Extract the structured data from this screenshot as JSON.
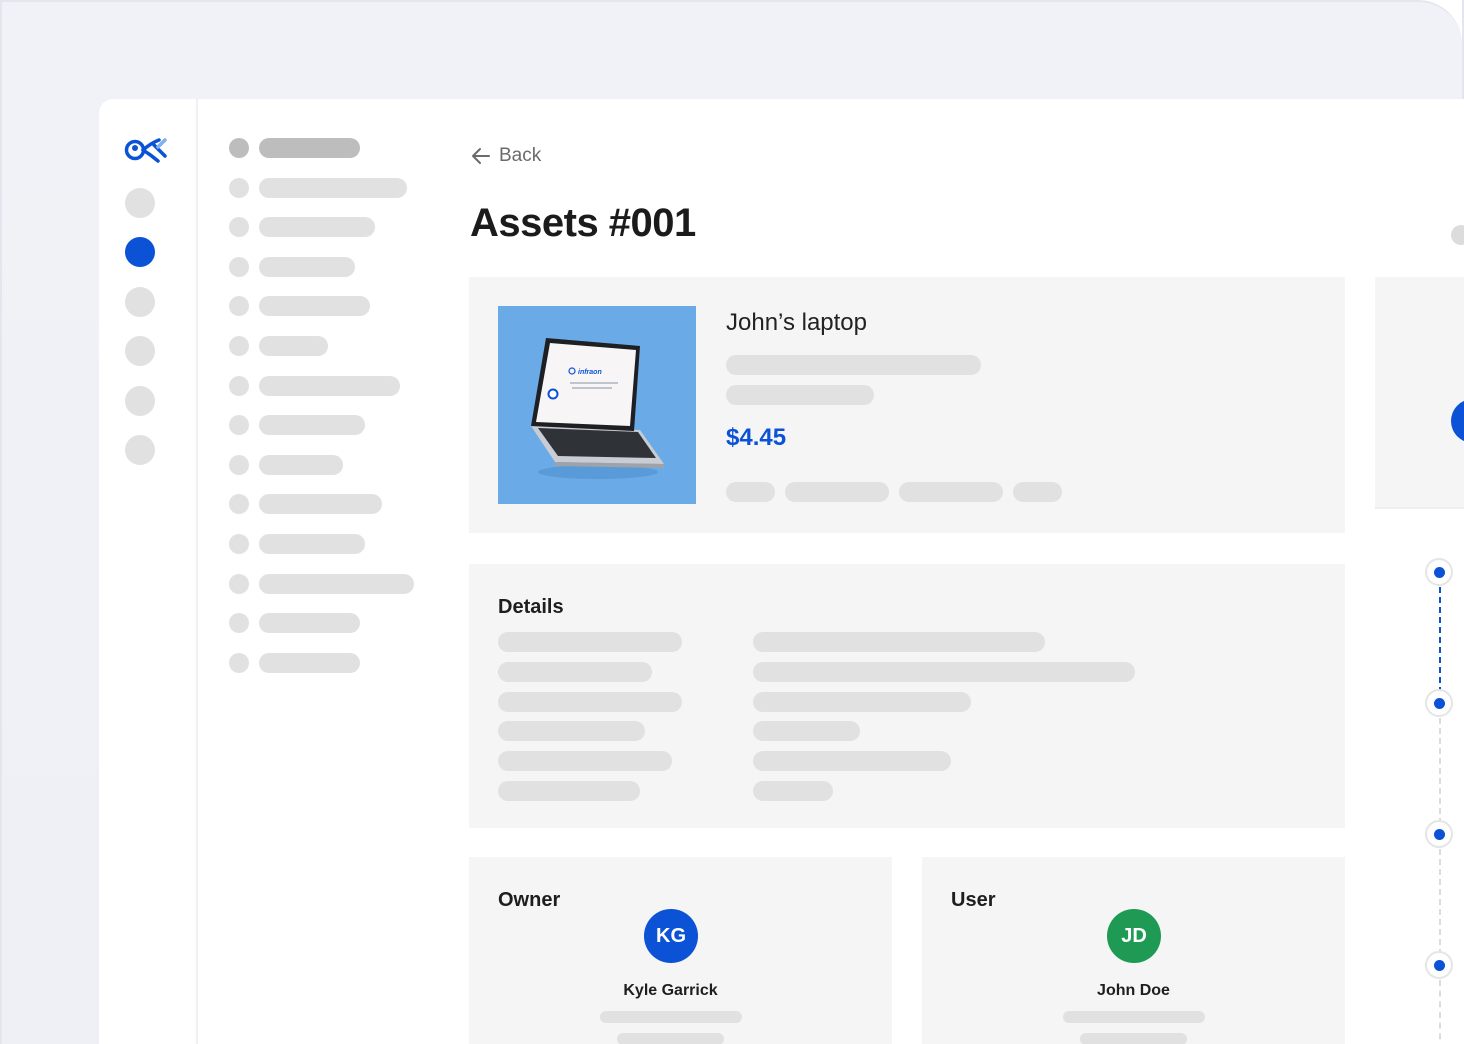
{
  "header": {
    "back_label": "Back",
    "title": "Assets #001"
  },
  "asset": {
    "name": "John’s laptop",
    "price": "$4.45",
    "image_icon": "laptop-illustration"
  },
  "details": {
    "heading": "Details"
  },
  "owner": {
    "heading": "Owner",
    "initials": "KG",
    "name": "Kyle Garrick",
    "avatar_color": "#0b52d6"
  },
  "user": {
    "heading": "User",
    "initials": "JD",
    "name": "John Doe",
    "avatar_color": "#1f9a55"
  },
  "colors": {
    "accent": "#0b52d6",
    "skeleton": "#e1e1e1",
    "card": "#f5f5f5"
  },
  "icons": {
    "logo": "infraon-logo-icon",
    "back": "arrow-left-icon"
  }
}
